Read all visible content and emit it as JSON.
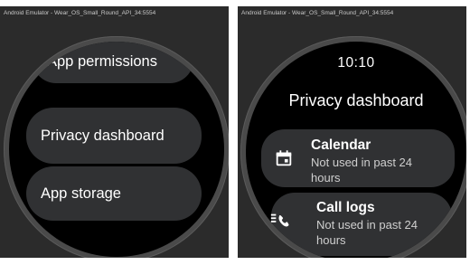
{
  "left_window": {
    "title": "Android Emulator - Wear_OS_Small_Round_API_34:5554",
    "items": [
      {
        "label": "App permissions"
      },
      {
        "label": "Privacy dashboard"
      },
      {
        "label": "App storage"
      }
    ]
  },
  "right_window": {
    "title": "Android Emulator - Wear_OS_Small_Round_API_34:5554",
    "time": "10:10",
    "heading": "Privacy dashboard",
    "cards": [
      {
        "title": "Calendar",
        "subtitle": "Not used in past 24 hours",
        "icon": "calendar-icon"
      },
      {
        "title": "Call logs",
        "subtitle": "Not used in past 24 hours",
        "icon": "call-log-icon"
      }
    ]
  }
}
